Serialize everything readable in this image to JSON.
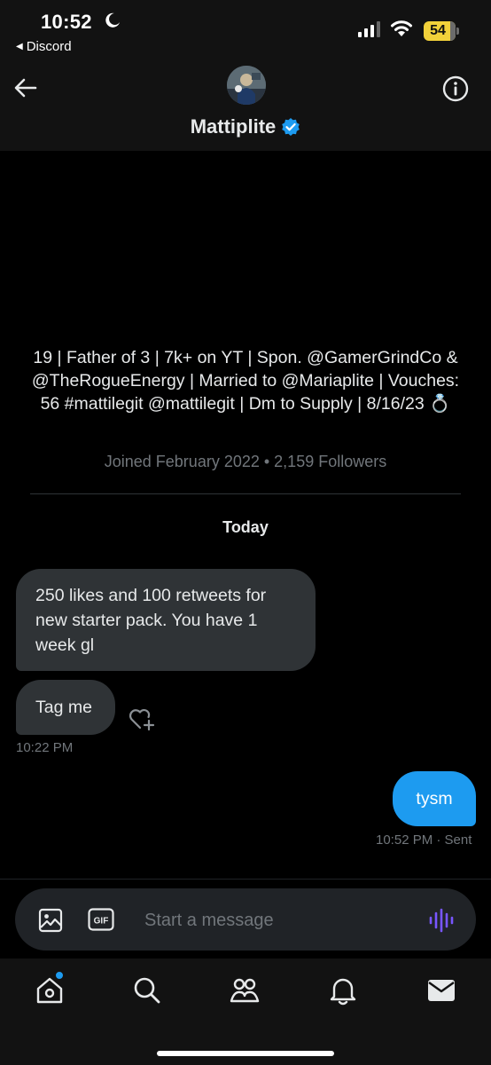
{
  "status_bar": {
    "time": "10:52",
    "back_app": "Discord",
    "battery": "54",
    "battery_color": "#f2d13a"
  },
  "header": {
    "display_name": "Mattiplite",
    "verified": true,
    "icons": [
      "back-arrow-icon",
      "avatar",
      "info-icon",
      "verified-badge-icon"
    ]
  },
  "profile": {
    "bio": "19 | Father of 3 | 7k+ on YT | Spon. @GamerGrindCo & @TheRogueEnergy | Married to @Mariaplite | Vouches: 56 #mattilegit @mattilegit | Dm to Supply | 8/16/23 💍",
    "joined": "Joined February 2022 • 2,159 Followers"
  },
  "conversation": {
    "day_label": "Today",
    "messages": [
      {
        "direction": "received",
        "text": "250 likes and 100 retweets for new starter pack. You have 1 week gl"
      },
      {
        "direction": "received",
        "text": "Tag me",
        "timestamp": "10:22 PM"
      },
      {
        "direction": "sent",
        "text": "tysm",
        "timestamp": "10:52 PM",
        "status": "· Sent"
      }
    ]
  },
  "composer": {
    "placeholder": "Start a message",
    "gif_label": "GIF",
    "icons": [
      "image-icon",
      "gif-icon",
      "voice-icon"
    ]
  },
  "tab_bar": {
    "tabs": [
      "home",
      "search",
      "communities",
      "notifications",
      "messages"
    ],
    "active": "messages"
  },
  "colors": {
    "accent": "#1d9bf0",
    "bubble_received": "#2f3336",
    "muted_text": "#71767b",
    "voice_icon": "#7856ff"
  }
}
